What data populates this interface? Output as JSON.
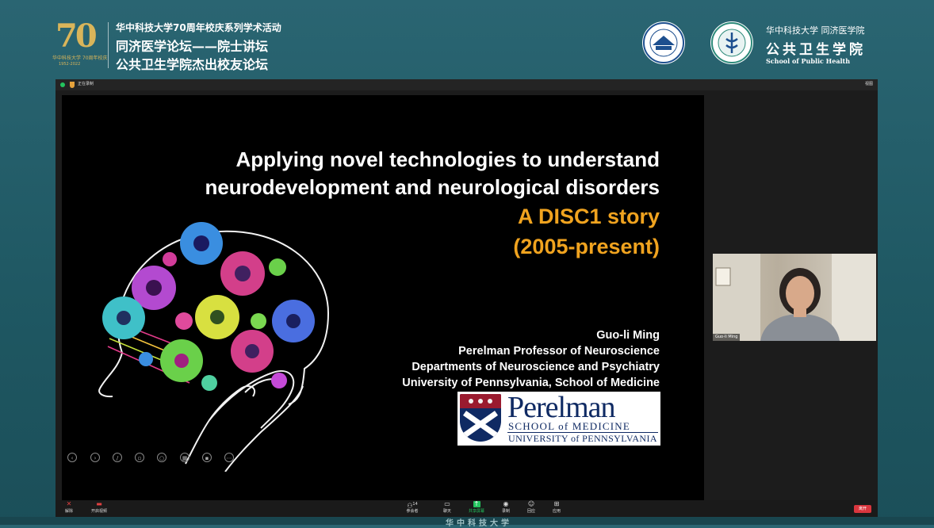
{
  "header": {
    "anniversary_logo": {
      "number": "70",
      "caption": "华中科技大学 70周年校庆",
      "years": "1952-2022"
    },
    "title_line1": "华中科技大学70周年校庆系列学术活动",
    "title_line2": "同济医学论坛——院士讲坛",
    "title_line3": "公共卫生学院杰出校友论坛",
    "school_line1": "华中科技大学 同济医学院",
    "school_line2": "公共卫生学院",
    "school_line3": "School of Public Health"
  },
  "meeting": {
    "topbar": {
      "recording_label": "正在录制",
      "view_label": "视图"
    },
    "slide": {
      "title_line1": "Applying novel technologies to understand",
      "title_line2": "neurodevelopment and neurological disorders",
      "subtitle_line1": "A DISC1 story",
      "subtitle_line2": "(2005-present)",
      "speaker_name": "Guo-li Ming",
      "speaker_title": "Perelman Professor of Neuroscience",
      "speaker_dept": "Departments of Neuroscience and Psychiatry",
      "speaker_univ": "University of Pennsylvania, School of Medicine",
      "logo_name": "Perelman",
      "logo_line2": "SCHOOL of MEDICINE",
      "logo_line3": "UNIVERSITY of PENNSYLVANIA",
      "annotation_tools": [
        "prev-icon",
        "next-icon",
        "pen-icon",
        "image-icon",
        "zoom-icon",
        "grid-icon",
        "camera-icon",
        "more-icon"
      ]
    },
    "video": {
      "participant_name": "Guo-li Ming"
    },
    "toolbar": {
      "mute_label": "解除",
      "video_label": "开启视频",
      "participants_label": "参会者",
      "participants_count": "14",
      "chat_label": "聊天",
      "share_label": "共享屏幕",
      "record_label": "录制",
      "reactions_label": "回应",
      "apps_label": "应用",
      "end_label": "离开"
    }
  },
  "footer_text": "华中科技大学",
  "colors": {
    "accent_orange": "#f0a31f",
    "penn_blue": "#0f2a63",
    "penn_red": "#9a1b2f",
    "end_red": "#d9363e"
  }
}
